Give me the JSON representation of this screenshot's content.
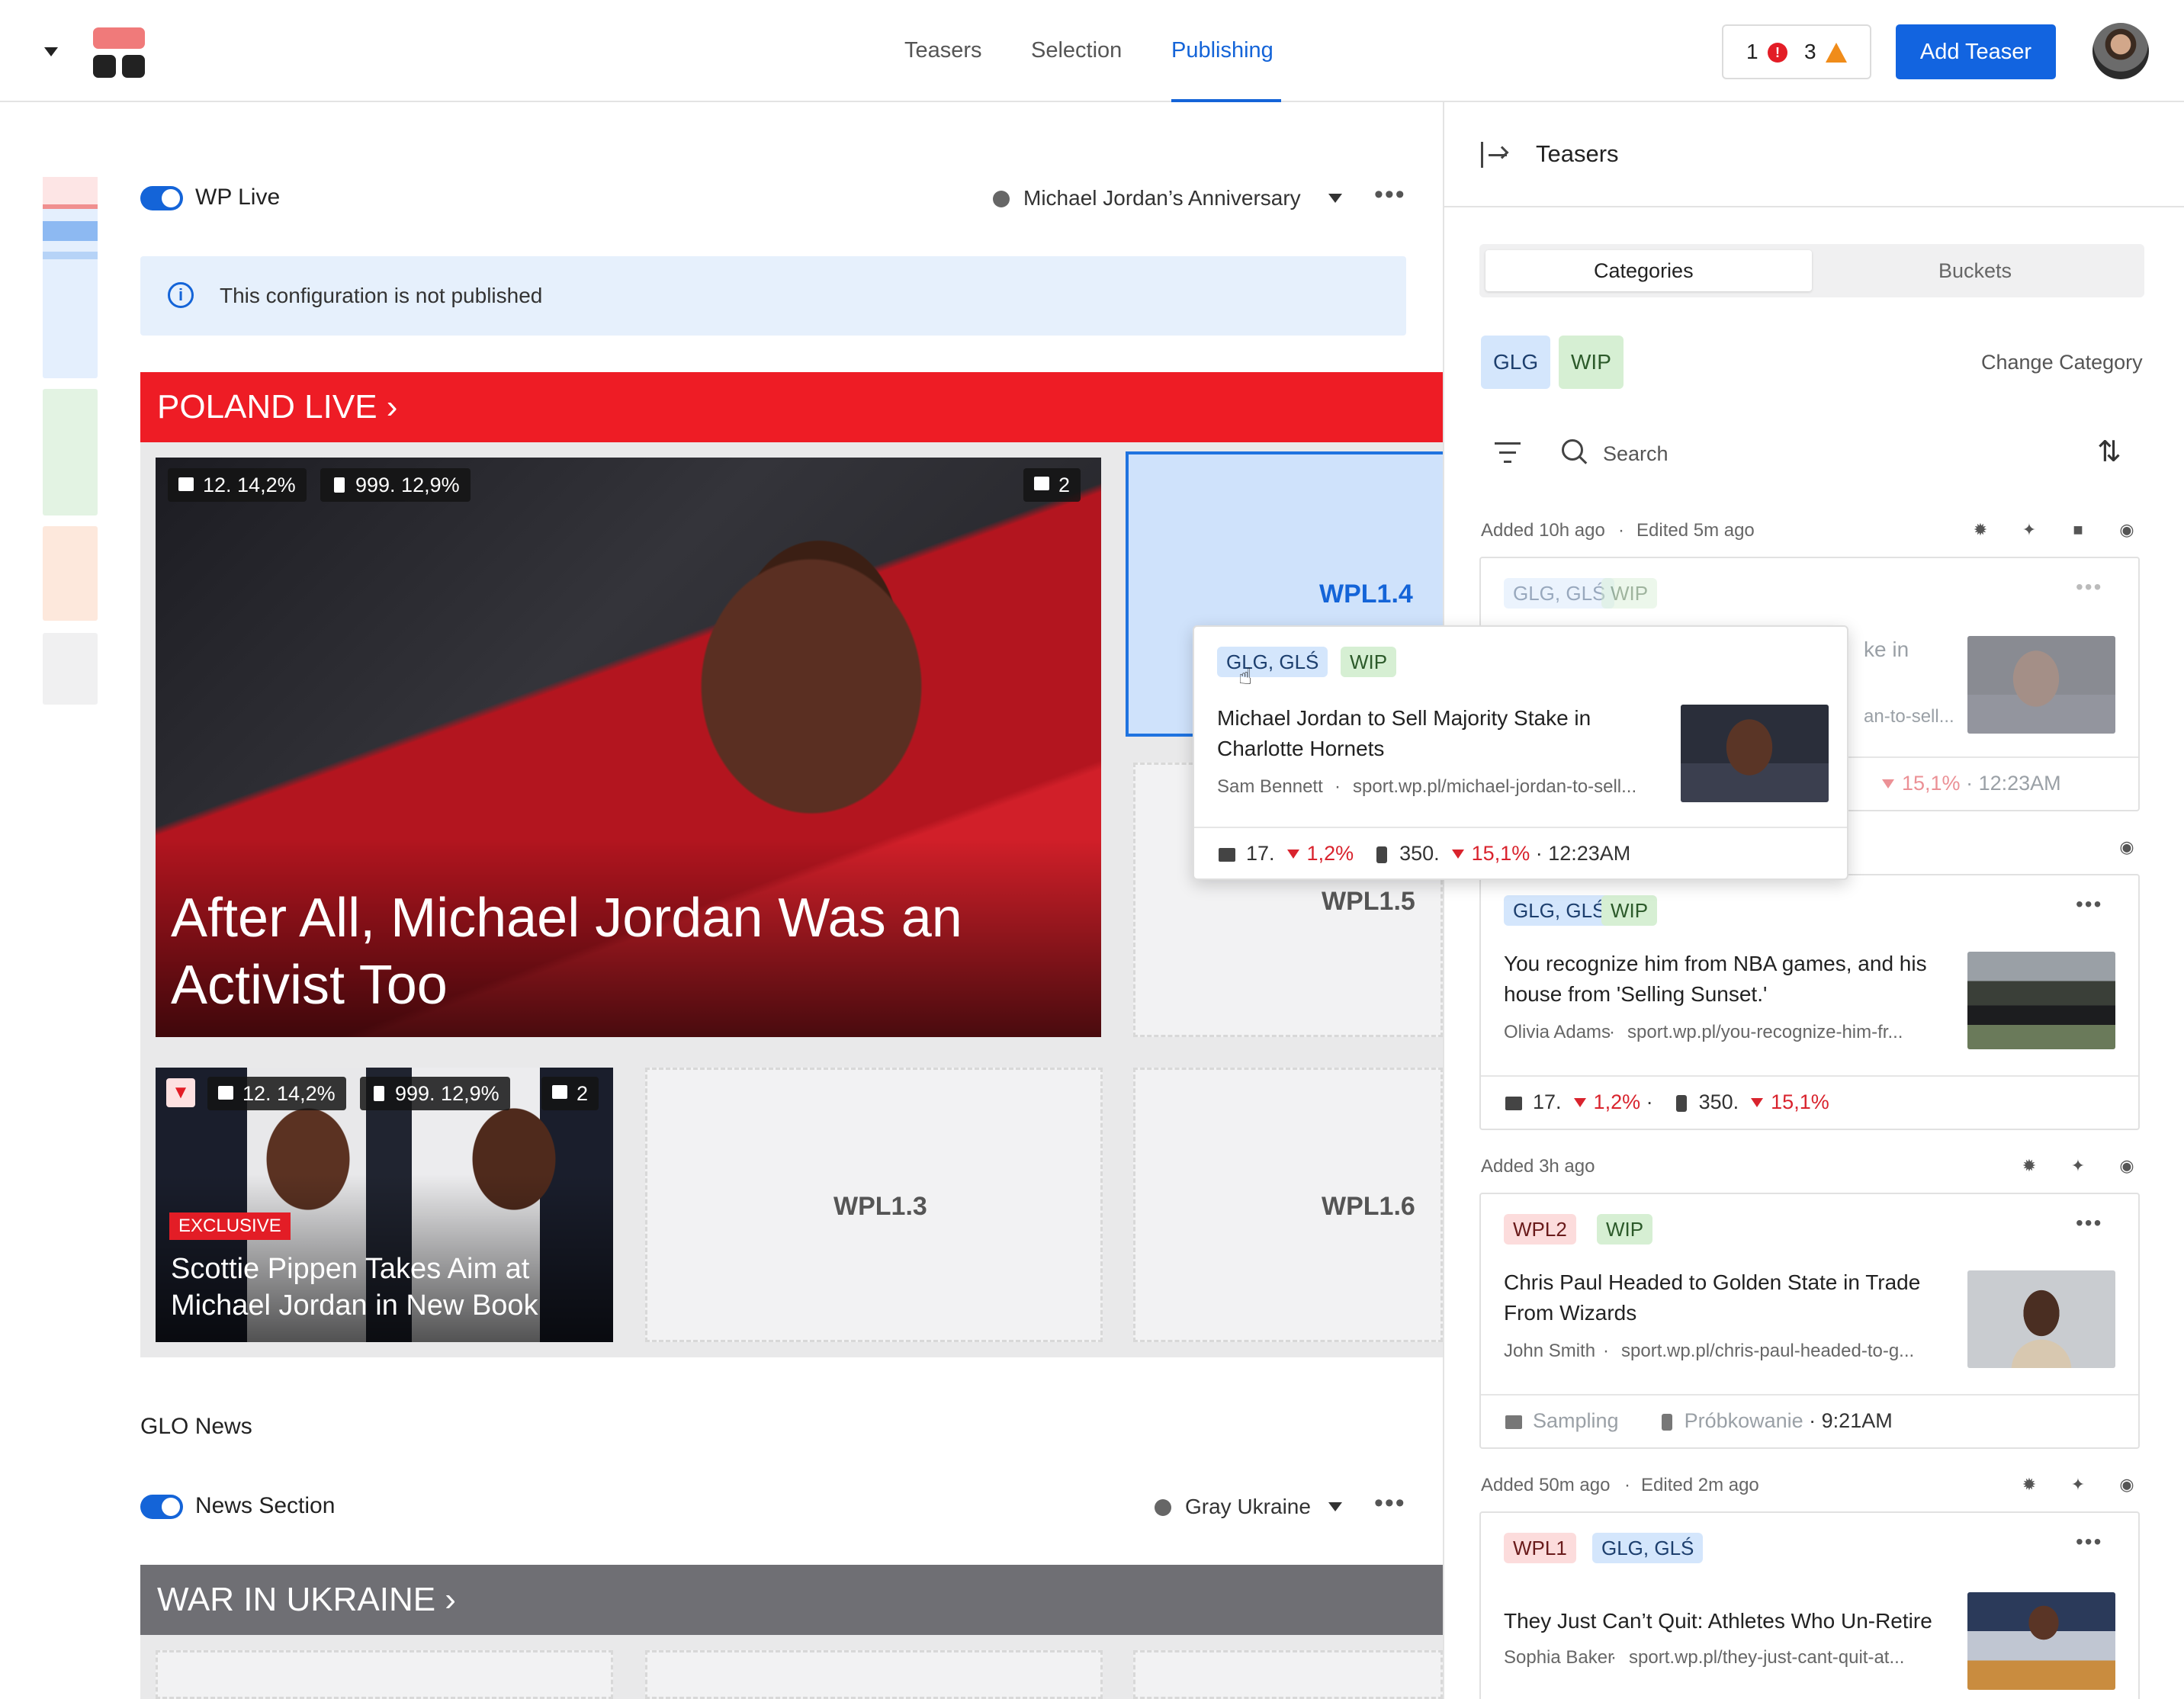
{
  "header": {
    "tabs": [
      "Teasers",
      "Selection",
      "Publishing"
    ],
    "active_tab": "Publishing",
    "errors_count": "1",
    "warnings_count": "3",
    "add_button": "Add Teaser"
  },
  "sections": [
    {
      "label": "WP Live",
      "dropdown": "Michael Jordan’s Anniversary",
      "info": "This configuration is not published",
      "banner": "POLAND LIVE",
      "banner_color": "#ee1c25",
      "big_card": {
        "desktop_stat": "12. 14,2%",
        "mobile_stat": "999. 12,9%",
        "count": "2",
        "title": "After All, Michael Jordan Was an Activist Too"
      },
      "small_card": {
        "desktop_stat": "12. 14,2%",
        "mobile_stat": "999. 12,9%",
        "count": "2",
        "badge": "EXCLUSIVE",
        "title": "Scottie Pippen Takes Aim at Michael Jordan in New Book"
      },
      "slots": [
        "WPL1.4",
        "WPL1.5",
        "WPL1.3",
        "WPL1.6"
      ]
    },
    {
      "group": "GLO News",
      "label": "News Section",
      "dropdown": "Gray Ukraine",
      "banner": "WAR IN UKRAINE",
      "banner_color": "#6f6f74"
    }
  ],
  "tooltip": {
    "tags": [
      "GLG, GLŚ",
      "WIP"
    ],
    "title": "Michael Jordan to Sell Majority Stake in Charlotte Hornets",
    "author": "Sam Bennett",
    "url": "sport.wp.pl/michael-jordan-to-sell...",
    "desktop": "17.",
    "desktop_change": "1,2%",
    "mobile": "350.",
    "mobile_change": "15,1%",
    "time": "12:23AM"
  },
  "panel": {
    "title": "Teasers",
    "seg_tabs": [
      "Categories",
      "Buckets"
    ],
    "active_seg": "Categories",
    "category_tags": [
      "GLG",
      "WIP"
    ],
    "change_category": "Change Category",
    "search_placeholder": "Search",
    "groups": [
      {
        "meta": "Added 10h ago",
        "meta2": "Edited 5m ago",
        "card": {
          "tags": [
            "GLG, GLŚ",
            "WIP"
          ],
          "title_fragment": "ke in",
          "url_fragment": "an-to-sell...",
          "stat_change": "15,1%",
          "time": "12:23AM"
        }
      },
      {
        "card": {
          "tags": [
            "GLG, GLŚ",
            "WIP"
          ],
          "title": "You recognize him from NBA games, and his house from 'Selling Sunset.'",
          "author": "Olivia Adams",
          "url": "sport.wp.pl/you-recognize-him-fr...",
          "desktop": "17.",
          "desktop_change": "1,2%",
          "mobile": "350.",
          "mobile_change": "15,1%"
        }
      },
      {
        "meta": "Added 3h ago",
        "card": {
          "tags": [
            "WPL2",
            "WIP"
          ],
          "title": "Chris Paul Headed to Golden State in Trade From Wizards",
          "author": "John Smith",
          "url": "sport.wp.pl/chris-paul-headed-to-g...",
          "desktop_label": "Sampling",
          "mobile_label": "Próbkowanie",
          "time": "9:21AM"
        }
      },
      {
        "meta": "Added 50m ago",
        "meta2": "Edited 2m ago",
        "card": {
          "tags": [
            "WPL1",
            "GLG, GLŚ"
          ],
          "title": "They Just Can’t Quit: Athletes Who Un-Retire",
          "author": "Sophia Baker",
          "url": "sport.wp.pl/they-just-cant-quit-at..."
        }
      }
    ]
  },
  "icons": [
    "menu-caret-icon",
    "logo-icon",
    "error-icon",
    "warning-icon",
    "info-icon",
    "monitor-icon",
    "phone-icon",
    "calendar-icon",
    "pin-icon",
    "filter-icon",
    "search-icon",
    "sort-icon",
    "collapse-panel-icon",
    "sun-icon",
    "lock-icon",
    "eye-icon",
    "more-icon"
  ],
  "colors": {
    "accent": "#1464d8",
    "error": "#e31d26",
    "warning": "#f08c1a"
  }
}
